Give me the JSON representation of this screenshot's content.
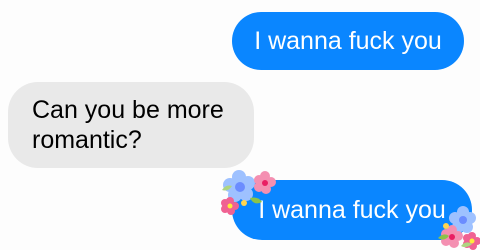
{
  "messages": [
    {
      "direction": "outgoing",
      "text": "I wanna fuck you"
    },
    {
      "direction": "incoming",
      "text": "Can you be more romantic?"
    },
    {
      "direction": "outgoing",
      "text": "I wanna fuck you",
      "decoration": "flower-stickers"
    }
  ],
  "colors": {
    "outgoing_bubble": "#0a86ff",
    "incoming_bubble": "#e9e9e9",
    "outgoing_text": "#ffffff",
    "incoming_text": "#000000"
  }
}
